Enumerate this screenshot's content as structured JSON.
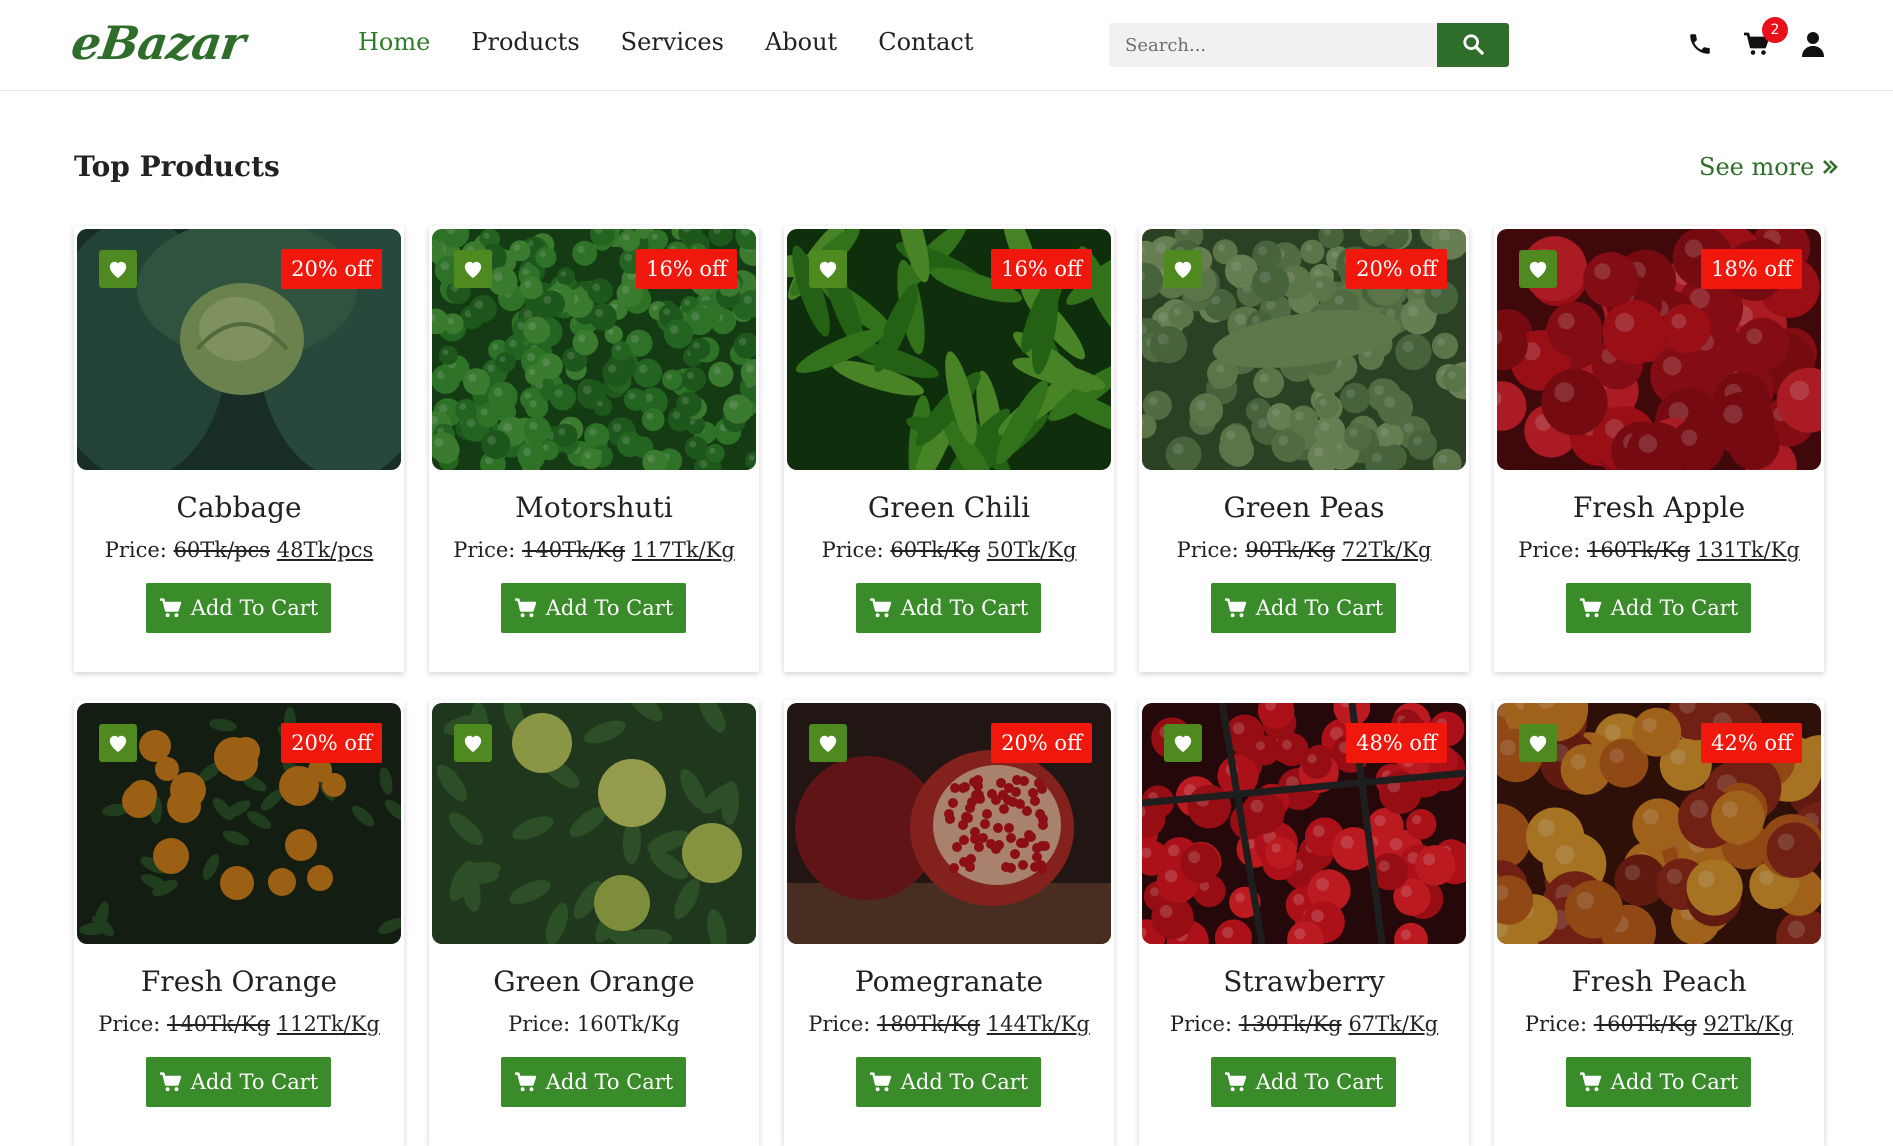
{
  "brand": {
    "logo": "eBazar"
  },
  "nav": [
    {
      "label": "Home",
      "active": true
    },
    {
      "label": "Products",
      "active": false
    },
    {
      "label": "Services",
      "active": false
    },
    {
      "label": "About",
      "active": false
    },
    {
      "label": "Contact",
      "active": false
    }
  ],
  "search": {
    "placeholder": "Search..."
  },
  "header_icons": {
    "phone": "phone-icon",
    "cart": "cart-icon",
    "user": "user-icon",
    "cart_count": "2"
  },
  "section": {
    "title": "Top Products",
    "see_more": "See more"
  },
  "price_label": "Price:",
  "add_to_cart_label": "Add To Cart",
  "colors": {
    "brand_green": "#2f6e2a",
    "button_green": "#3a8b2a",
    "discount_red": "#f0180c",
    "badge_red": "#e8101a"
  },
  "products": [
    {
      "name": "Cabbage",
      "discount": "20% off",
      "old_price": "60Tk/pcs",
      "new_price": "48Tk/pcs"
    },
    {
      "name": "Motorshuti",
      "discount": "16% off",
      "old_price": "140Tk/Kg",
      "new_price": "117Tk/Kg"
    },
    {
      "name": "Green Chili",
      "discount": "16% off",
      "old_price": "60Tk/Kg",
      "new_price": "50Tk/Kg"
    },
    {
      "name": "Green Peas",
      "discount": "20% off",
      "old_price": "90Tk/Kg",
      "new_price": "72Tk/Kg"
    },
    {
      "name": "Fresh Apple",
      "discount": "18% off",
      "old_price": "160Tk/Kg",
      "new_price": "131Tk/Kg"
    },
    {
      "name": "Fresh Orange",
      "discount": "20% off",
      "old_price": "140Tk/Kg",
      "new_price": "112Tk/Kg"
    },
    {
      "name": "Green Orange",
      "discount": "",
      "old_price": "",
      "new_price": "",
      "price": "160Tk/Kg"
    },
    {
      "name": "Pomegranate",
      "discount": "20% off",
      "old_price": "180Tk/Kg",
      "new_price": "144Tk/Kg"
    },
    {
      "name": "Strawberry",
      "discount": "48% off",
      "old_price": "130Tk/Kg",
      "new_price": "67Tk/Kg"
    },
    {
      "name": "Fresh Peach",
      "discount": "42% off",
      "old_price": "160Tk/Kg",
      "new_price": "92Tk/Kg"
    }
  ]
}
